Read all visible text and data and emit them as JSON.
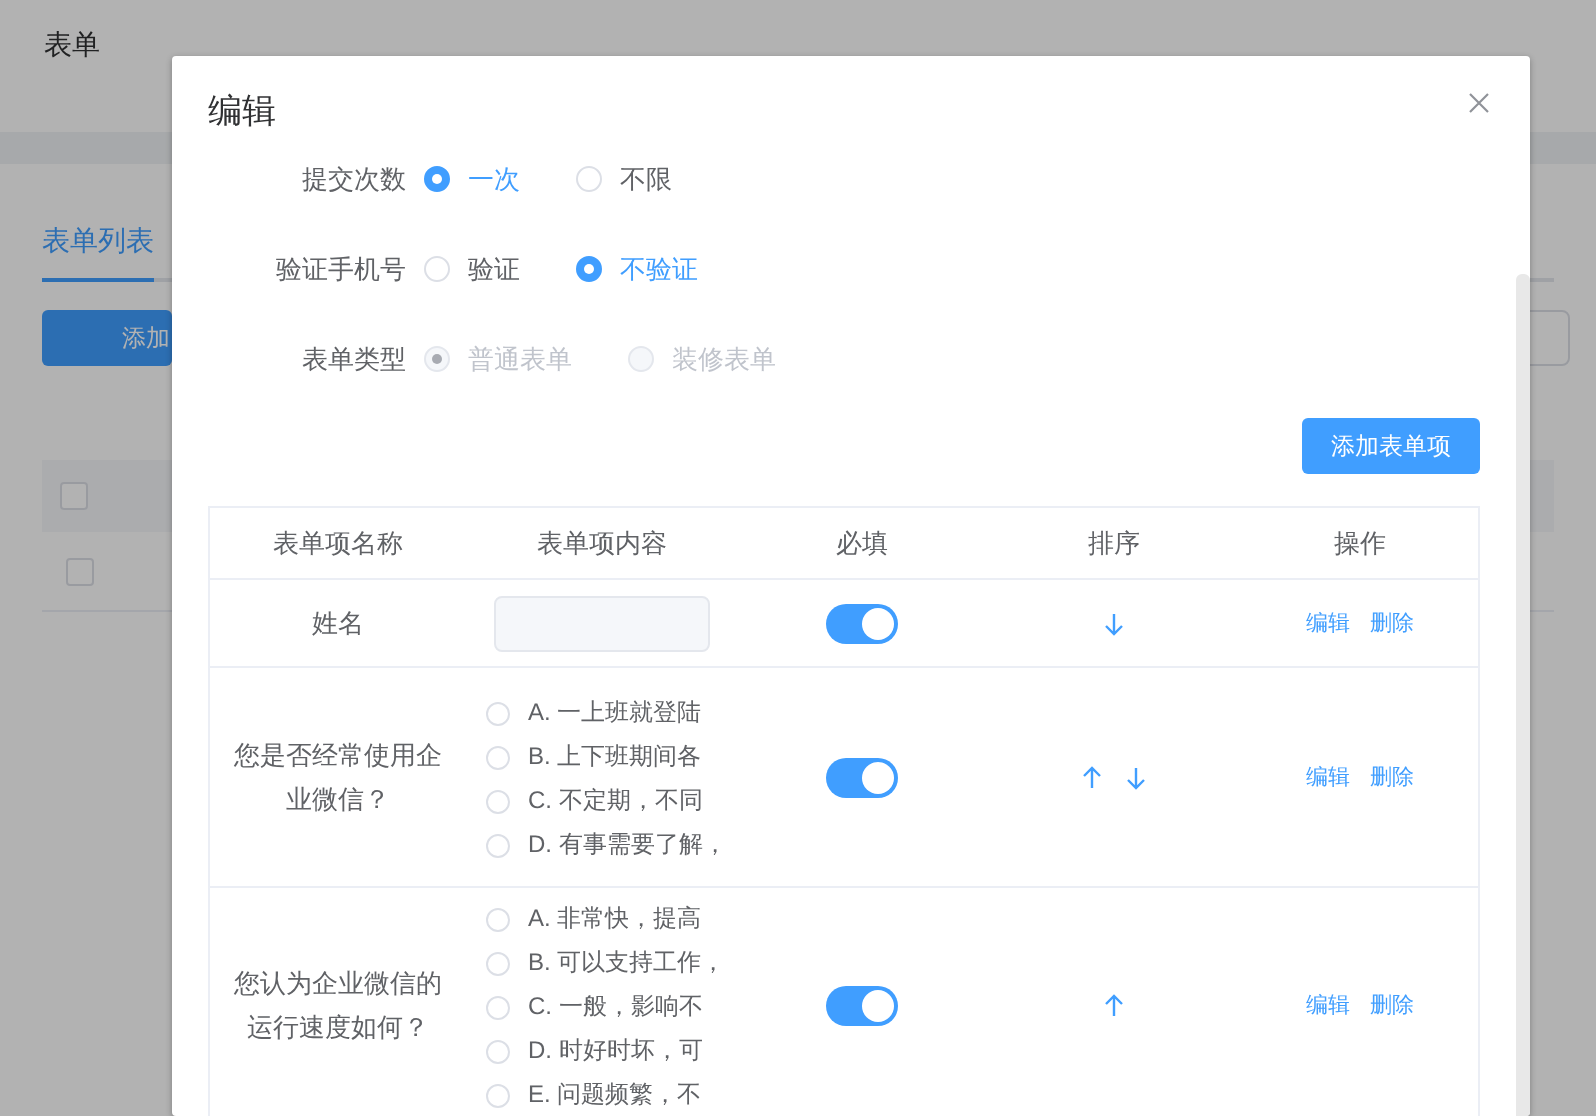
{
  "page": {
    "title": "表单",
    "tab": "表单列表",
    "add_button": "添加",
    "rows": [
      {
        "checked": false
      },
      {
        "checked": false
      }
    ]
  },
  "dialog": {
    "title": "编辑",
    "fields": [
      {
        "label": "提交次数",
        "disabled": false,
        "options": [
          {
            "label": "一次",
            "selected": true
          },
          {
            "label": "不限",
            "selected": false
          }
        ]
      },
      {
        "label": "验证手机号",
        "disabled": false,
        "options": [
          {
            "label": "验证",
            "selected": false
          },
          {
            "label": "不验证",
            "selected": true
          }
        ]
      },
      {
        "label": "表单类型",
        "disabled": true,
        "options": [
          {
            "label": "普通表单",
            "selected": true
          },
          {
            "label": "装修表单",
            "selected": false
          }
        ]
      }
    ],
    "add_item_button": "添加表单项",
    "table": {
      "columns": [
        "表单项名称",
        "表单项内容",
        "必填",
        "排序",
        "操作"
      ],
      "rows": [
        {
          "name": "姓名",
          "kind": "text",
          "required": true,
          "move_up": false,
          "move_down": true,
          "actions": [
            "编辑",
            "删除"
          ]
        },
        {
          "name": "您是否经常使用企业微信？",
          "kind": "choice",
          "options": [
            {
              "label": "A. 一上班就登陆",
              "selected": false
            },
            {
              "label": "B. 上下班期间各",
              "selected": false
            },
            {
              "label": "C. 不定期，不同",
              "selected": false
            },
            {
              "label": "D. 有事需要了解，",
              "selected": false
            }
          ],
          "required": true,
          "move_up": true,
          "move_down": true,
          "actions": [
            "编辑",
            "删除"
          ]
        },
        {
          "name": "您认为企业微信的运行速度如何？",
          "kind": "choice",
          "options": [
            {
              "label": "A. 非常快，提高",
              "selected": false
            },
            {
              "label": "B. 可以支持工作，",
              "selected": false
            },
            {
              "label": "C. 一般，影响不",
              "selected": false
            },
            {
              "label": "D. 时好时坏，可",
              "selected": false
            },
            {
              "label": "E. 问题频繁，不",
              "selected": false
            }
          ],
          "required": true,
          "move_up": true,
          "move_down": false,
          "actions": [
            "编辑",
            "删除"
          ]
        }
      ]
    }
  }
}
